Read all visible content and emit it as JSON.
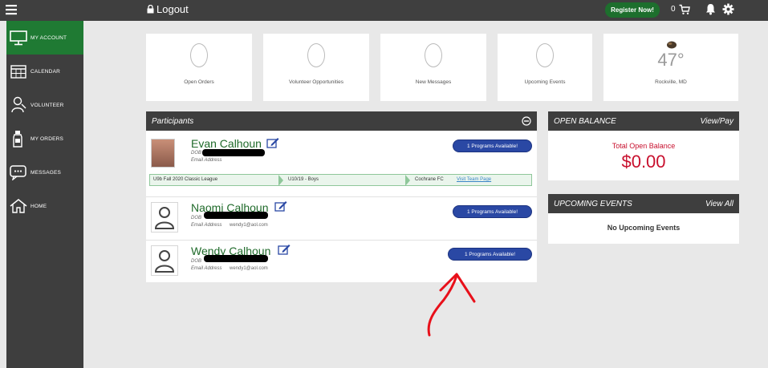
{
  "topbar": {
    "logout_label": "Logout",
    "register_label": "Register Now!",
    "cart_count": "0"
  },
  "sidebar": {
    "items": [
      {
        "label": "MY ACCOUNT",
        "icon": "monitor-icon",
        "active": true
      },
      {
        "label": "CALENDAR",
        "icon": "calendar-icon"
      },
      {
        "label": "VOLUNTEER",
        "icon": "volunteer-icon"
      },
      {
        "label": "MY ORDERS",
        "icon": "bottle-icon"
      },
      {
        "label": "MESSAGES",
        "icon": "chat-icon"
      },
      {
        "label": "HOME",
        "icon": "home-icon"
      }
    ]
  },
  "tiles": [
    {
      "label": "Open Orders"
    },
    {
      "label": "Volunteer Opportunities"
    },
    {
      "label": "New Messages"
    },
    {
      "label": "Upcoming Events"
    },
    {
      "label": "Rockville, MD",
      "temp": "47°"
    }
  ],
  "participants": {
    "header": "Participants",
    "people": [
      {
        "name": "Evan Calhoun",
        "dob_label": "DOB",
        "email_label": "Email Address",
        "email": "",
        "button": "1 Programs Available!",
        "league": {
          "program": "U9b Fall 2020 Classic League",
          "team_level": "U10/19 - Boys",
          "club": "Cochrane FC",
          "link": "Visit Team Page"
        }
      },
      {
        "name": "Naomi Calhoun",
        "dob_label": "DOB",
        "email_label": "Email Address",
        "email": "wendy1@aol.com",
        "button": "1 Programs Available!"
      },
      {
        "name": "Wendy Calhoun",
        "dob_label": "DOB",
        "email_label": "Email Address",
        "email": "wendy1@aol.com",
        "button": "1 Programs Available!"
      }
    ]
  },
  "balance": {
    "header": "OPEN BALANCE",
    "action": "View/Pay",
    "label": "Total Open Balance",
    "amount": "$0.00"
  },
  "events": {
    "header": "UPCOMING EVENTS",
    "action": "View All",
    "empty": "No Upcoming Events"
  },
  "colors": {
    "accent_green": "#1f7a33",
    "dark_gray": "#3e3e3e",
    "balance_red": "#c8102e",
    "button_blue": "#2a48a4"
  }
}
